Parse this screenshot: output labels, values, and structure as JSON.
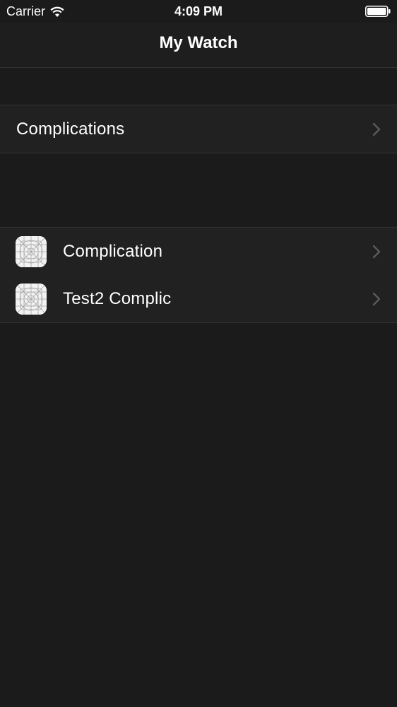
{
  "status_bar": {
    "carrier": "Carrier",
    "time": "4:09 PM",
    "wifi_icon": "wifi-icon",
    "battery_icon": "battery-icon"
  },
  "nav": {
    "title": "My Watch"
  },
  "section1": {
    "items": [
      {
        "label": "Complications",
        "chevron_icon": "chevron-right-icon"
      }
    ]
  },
  "section2": {
    "items": [
      {
        "label": "Complication",
        "icon": "app-icon-placeholder",
        "chevron_icon": "chevron-right-icon"
      },
      {
        "label": "Test2 Complic",
        "icon": "app-icon-placeholder",
        "chevron_icon": "chevron-right-icon"
      }
    ]
  },
  "colors": {
    "background": "#1b1b1b",
    "cell_background": "#212121",
    "separator": "#333333",
    "text": "#ffffff",
    "chevron": "#5a5a5a"
  }
}
